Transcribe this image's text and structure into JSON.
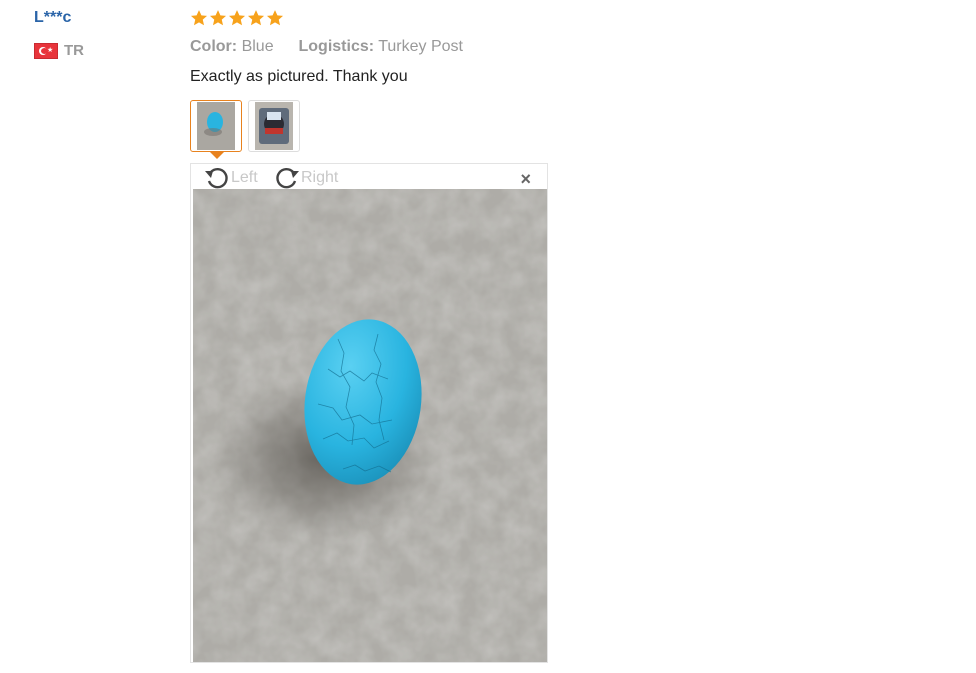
{
  "reviewer": {
    "name": "L***c",
    "country_code": "TR"
  },
  "rating": {
    "stars": 5,
    "max": 5,
    "color": "#f7a21b"
  },
  "attributes": {
    "color_label": "Color:",
    "color_value": "Blue",
    "logistics_label": "Logistics:",
    "logistics_value": "Turkey Post"
  },
  "review_text": "Exactly as pictured. Thank you",
  "viewer": {
    "rotate_left_label": "Left",
    "rotate_right_label": "Right",
    "close_label": "×"
  },
  "colors": {
    "accent": "#e8821e",
    "username": "#2a64a8",
    "egg": "#29b4e0",
    "carpet": "#9a9893"
  }
}
